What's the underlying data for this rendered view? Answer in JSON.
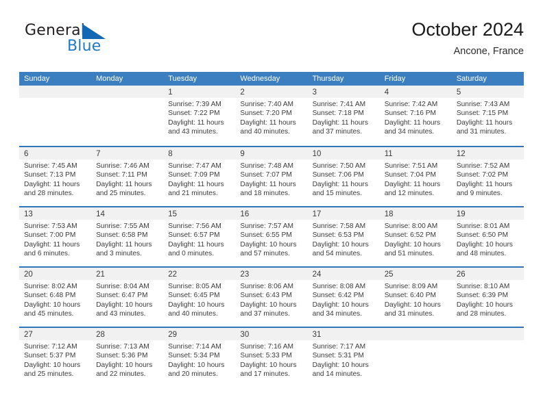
{
  "brand": {
    "name_top": "General",
    "name_bottom": "Blue",
    "accent_color": "#1268b3",
    "text_color": "#231f20"
  },
  "header": {
    "title": "October 2024",
    "subtitle": "Ancone, France"
  },
  "calendar": {
    "header_bg": "#3c7fc1",
    "row_border_color": "#2f76b8",
    "date_band_bg": "#f1f1f1",
    "weekdays": [
      "Sunday",
      "Monday",
      "Tuesday",
      "Wednesday",
      "Thursday",
      "Friday",
      "Saturday"
    ],
    "weeks": [
      [
        {
          "day": "",
          "empty": true
        },
        {
          "day": "",
          "empty": true
        },
        {
          "day": "1",
          "sunrise": "Sunrise: 7:39 AM",
          "sunset": "Sunset: 7:22 PM",
          "daylight1": "Daylight: 11 hours",
          "daylight2": "and 43 minutes."
        },
        {
          "day": "2",
          "sunrise": "Sunrise: 7:40 AM",
          "sunset": "Sunset: 7:20 PM",
          "daylight1": "Daylight: 11 hours",
          "daylight2": "and 40 minutes."
        },
        {
          "day": "3",
          "sunrise": "Sunrise: 7:41 AM",
          "sunset": "Sunset: 7:18 PM",
          "daylight1": "Daylight: 11 hours",
          "daylight2": "and 37 minutes."
        },
        {
          "day": "4",
          "sunrise": "Sunrise: 7:42 AM",
          "sunset": "Sunset: 7:16 PM",
          "daylight1": "Daylight: 11 hours",
          "daylight2": "and 34 minutes."
        },
        {
          "day": "5",
          "sunrise": "Sunrise: 7:43 AM",
          "sunset": "Sunset: 7:15 PM",
          "daylight1": "Daylight: 11 hours",
          "daylight2": "and 31 minutes."
        }
      ],
      [
        {
          "day": "6",
          "sunrise": "Sunrise: 7:45 AM",
          "sunset": "Sunset: 7:13 PM",
          "daylight1": "Daylight: 11 hours",
          "daylight2": "and 28 minutes."
        },
        {
          "day": "7",
          "sunrise": "Sunrise: 7:46 AM",
          "sunset": "Sunset: 7:11 PM",
          "daylight1": "Daylight: 11 hours",
          "daylight2": "and 25 minutes."
        },
        {
          "day": "8",
          "sunrise": "Sunrise: 7:47 AM",
          "sunset": "Sunset: 7:09 PM",
          "daylight1": "Daylight: 11 hours",
          "daylight2": "and 21 minutes."
        },
        {
          "day": "9",
          "sunrise": "Sunrise: 7:48 AM",
          "sunset": "Sunset: 7:07 PM",
          "daylight1": "Daylight: 11 hours",
          "daylight2": "and 18 minutes."
        },
        {
          "day": "10",
          "sunrise": "Sunrise: 7:50 AM",
          "sunset": "Sunset: 7:06 PM",
          "daylight1": "Daylight: 11 hours",
          "daylight2": "and 15 minutes."
        },
        {
          "day": "11",
          "sunrise": "Sunrise: 7:51 AM",
          "sunset": "Sunset: 7:04 PM",
          "daylight1": "Daylight: 11 hours",
          "daylight2": "and 12 minutes."
        },
        {
          "day": "12",
          "sunrise": "Sunrise: 7:52 AM",
          "sunset": "Sunset: 7:02 PM",
          "daylight1": "Daylight: 11 hours",
          "daylight2": "and 9 minutes."
        }
      ],
      [
        {
          "day": "13",
          "sunrise": "Sunrise: 7:53 AM",
          "sunset": "Sunset: 7:00 PM",
          "daylight1": "Daylight: 11 hours",
          "daylight2": "and 6 minutes."
        },
        {
          "day": "14",
          "sunrise": "Sunrise: 7:55 AM",
          "sunset": "Sunset: 6:58 PM",
          "daylight1": "Daylight: 11 hours",
          "daylight2": "and 3 minutes."
        },
        {
          "day": "15",
          "sunrise": "Sunrise: 7:56 AM",
          "sunset": "Sunset: 6:57 PM",
          "daylight1": "Daylight: 11 hours",
          "daylight2": "and 0 minutes."
        },
        {
          "day": "16",
          "sunrise": "Sunrise: 7:57 AM",
          "sunset": "Sunset: 6:55 PM",
          "daylight1": "Daylight: 10 hours",
          "daylight2": "and 57 minutes."
        },
        {
          "day": "17",
          "sunrise": "Sunrise: 7:58 AM",
          "sunset": "Sunset: 6:53 PM",
          "daylight1": "Daylight: 10 hours",
          "daylight2": "and 54 minutes."
        },
        {
          "day": "18",
          "sunrise": "Sunrise: 8:00 AM",
          "sunset": "Sunset: 6:52 PM",
          "daylight1": "Daylight: 10 hours",
          "daylight2": "and 51 minutes."
        },
        {
          "day": "19",
          "sunrise": "Sunrise: 8:01 AM",
          "sunset": "Sunset: 6:50 PM",
          "daylight1": "Daylight: 10 hours",
          "daylight2": "and 48 minutes."
        }
      ],
      [
        {
          "day": "20",
          "sunrise": "Sunrise: 8:02 AM",
          "sunset": "Sunset: 6:48 PM",
          "daylight1": "Daylight: 10 hours",
          "daylight2": "and 45 minutes."
        },
        {
          "day": "21",
          "sunrise": "Sunrise: 8:04 AM",
          "sunset": "Sunset: 6:47 PM",
          "daylight1": "Daylight: 10 hours",
          "daylight2": "and 43 minutes."
        },
        {
          "day": "22",
          "sunrise": "Sunrise: 8:05 AM",
          "sunset": "Sunset: 6:45 PM",
          "daylight1": "Daylight: 10 hours",
          "daylight2": "and 40 minutes."
        },
        {
          "day": "23",
          "sunrise": "Sunrise: 8:06 AM",
          "sunset": "Sunset: 6:43 PM",
          "daylight1": "Daylight: 10 hours",
          "daylight2": "and 37 minutes."
        },
        {
          "day": "24",
          "sunrise": "Sunrise: 8:08 AM",
          "sunset": "Sunset: 6:42 PM",
          "daylight1": "Daylight: 10 hours",
          "daylight2": "and 34 minutes."
        },
        {
          "day": "25",
          "sunrise": "Sunrise: 8:09 AM",
          "sunset": "Sunset: 6:40 PM",
          "daylight1": "Daylight: 10 hours",
          "daylight2": "and 31 minutes."
        },
        {
          "day": "26",
          "sunrise": "Sunrise: 8:10 AM",
          "sunset": "Sunset: 6:39 PM",
          "daylight1": "Daylight: 10 hours",
          "daylight2": "and 28 minutes."
        }
      ],
      [
        {
          "day": "27",
          "sunrise": "Sunrise: 7:12 AM",
          "sunset": "Sunset: 5:37 PM",
          "daylight1": "Daylight: 10 hours",
          "daylight2": "and 25 minutes."
        },
        {
          "day": "28",
          "sunrise": "Sunrise: 7:13 AM",
          "sunset": "Sunset: 5:36 PM",
          "daylight1": "Daylight: 10 hours",
          "daylight2": "and 22 minutes."
        },
        {
          "day": "29",
          "sunrise": "Sunrise: 7:14 AM",
          "sunset": "Sunset: 5:34 PM",
          "daylight1": "Daylight: 10 hours",
          "daylight2": "and 20 minutes."
        },
        {
          "day": "30",
          "sunrise": "Sunrise: 7:16 AM",
          "sunset": "Sunset: 5:33 PM",
          "daylight1": "Daylight: 10 hours",
          "daylight2": "and 17 minutes."
        },
        {
          "day": "31",
          "sunrise": "Sunrise: 7:17 AM",
          "sunset": "Sunset: 5:31 PM",
          "daylight1": "Daylight: 10 hours",
          "daylight2": "and 14 minutes."
        },
        {
          "day": "",
          "empty": true
        },
        {
          "day": "",
          "empty": true
        }
      ]
    ]
  }
}
